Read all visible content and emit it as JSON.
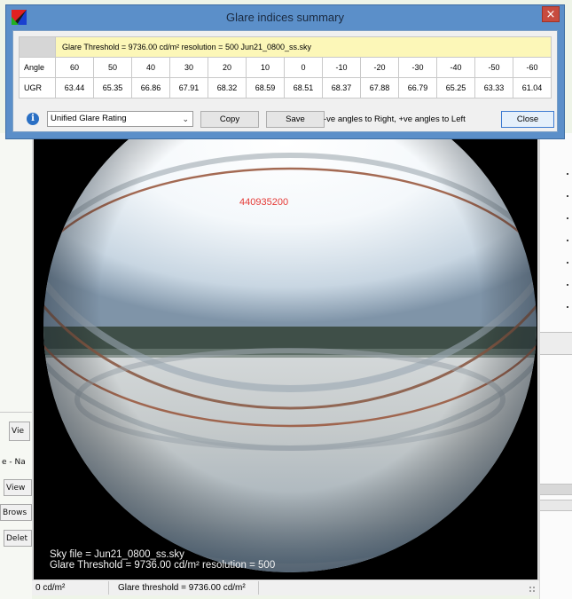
{
  "dialog": {
    "title": "Glare indices summary",
    "close_glyph": "×",
    "app_icon": "colour-triangle-icon",
    "info_line": "Glare Threshold = 9736.00 cd/m²   resolution = 500   Jun21_0800_ss.sky",
    "table": {
      "row_headers": [
        "Angle",
        "UGR"
      ],
      "angles": [
        "60",
        "50",
        "40",
        "30",
        "20",
        "10",
        "0",
        "-10",
        "-20",
        "-30",
        "-40",
        "-50",
        "-60"
      ],
      "ugr": [
        "63.44",
        "65.35",
        "66.86",
        "67.91",
        "68.32",
        "68.59",
        "68.51",
        "68.37",
        "67.88",
        "66.79",
        "65.25",
        "63.33",
        "61.04"
      ]
    },
    "info_icon_glyph": "i",
    "index_select": {
      "selected": "Unified Glare Rating"
    },
    "copy_label": "Copy",
    "save_label": "Save",
    "hint": "-ve angles to Right, +ve angles to Left",
    "close_label": "Close"
  },
  "image_view": {
    "peak_value": "440935200",
    "overlay_line1": "Sky file = Jun21_0800_ss.sky",
    "overlay_line2": "Glare Threshold = 9736.00 cd/m²  resolution = 500",
    "status_left": "0 cd/m²",
    "status_right": "Glare threshold = 9736.00 cd/m²"
  },
  "background_panel": {
    "items": [
      "Vie",
      "e - Na",
      "View",
      "Brows",
      "Delet"
    ]
  },
  "colors": {
    "title_bar": "#5b8fc9",
    "close_red": "#c74b3f",
    "info_row": "#fcf7b8",
    "peak_red": "#e53935"
  }
}
